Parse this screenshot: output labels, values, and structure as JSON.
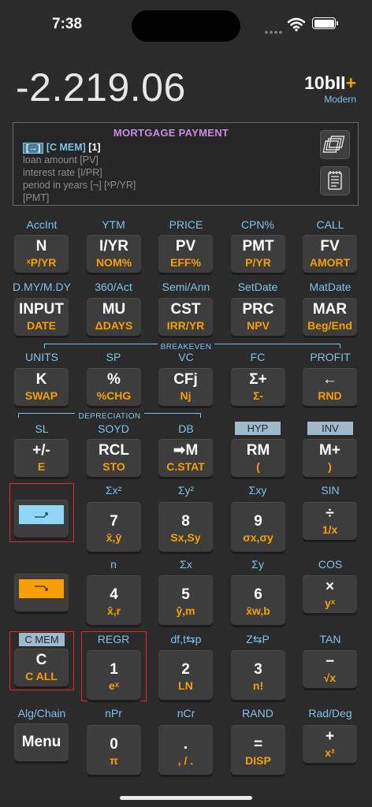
{
  "status": {
    "time": "7:38"
  },
  "display": {
    "value": "-2.219.06"
  },
  "brand": {
    "name": "10bII",
    "plus": "+",
    "subtitle": "Modern"
  },
  "panel": {
    "title": "MORTGAGE PAYMENT",
    "line1_box": "[→]",
    "line1_mem": "[C MEM]",
    "line1_num": "[1]",
    "line2": "loan amount   [PV]",
    "line3": "interest rate   [I/PR]",
    "line4": "period in years   [¬]  [ˣP/YR]",
    "line5": "[PMT]"
  },
  "labels": {
    "r1": [
      "AccInt",
      "YTM",
      "PRICE",
      "CPN%",
      "CALL"
    ],
    "r2": [
      "D.MY/M.DY",
      "360/Act",
      "Semi/Ann",
      "SetDate",
      "MatDate"
    ],
    "breakeven": "BREAKEVEN",
    "r3": [
      "UNITS",
      "SP",
      "VC",
      "FC",
      "PROFIT"
    ],
    "depreciation": "DEPRECIATION",
    "r4": [
      "SL",
      "SOYD",
      "DB",
      "HYP",
      "INV"
    ],
    "r5": [
      "Σx²",
      "Σy²",
      "Σxy",
      "SIN"
    ],
    "r6": [
      "n",
      "Σx",
      "Σy",
      "COS"
    ],
    "r7": [
      "C MEM",
      "REGR",
      "df,t⇆p",
      "Z⇆P",
      "TAN"
    ],
    "r8": [
      "Alg/Chain",
      "nPr",
      "nCr",
      "RAND",
      "Rad/Deg"
    ]
  },
  "keys": {
    "row1": [
      {
        "main": "N",
        "sub": "ˣP/YR"
      },
      {
        "main": "I/YR",
        "sub": "NOM%"
      },
      {
        "main": "PV",
        "sub": "EFF%"
      },
      {
        "main": "PMT",
        "sub": "P/YR"
      },
      {
        "main": "FV",
        "sub": "AMORT"
      }
    ],
    "row2": [
      {
        "main": "INPUT",
        "sub": "DATE"
      },
      {
        "main": "MU",
        "sub": "ΔDAYS"
      },
      {
        "main": "CST",
        "sub": "IRR/YR"
      },
      {
        "main": "PRC",
        "sub": "NPV"
      },
      {
        "main": "MAR",
        "sub": "Beg/End"
      }
    ],
    "row3": [
      {
        "main": "K",
        "sub": "SWAP"
      },
      {
        "main": "%",
        "sub": "%CHG"
      },
      {
        "main": "CFj",
        "sub": "Nj"
      },
      {
        "main": "Σ+",
        "sub": "Σ-"
      },
      {
        "main": "←",
        "sub": "RND"
      }
    ],
    "row4": [
      {
        "main": "+/-",
        "sub": "E"
      },
      {
        "main": "RCL",
        "sub": "STO"
      },
      {
        "main": "➡M",
        "sub": "C.STAT"
      },
      {
        "main": "RM",
        "sub": "("
      },
      {
        "main": "M+",
        "sub": ")"
      }
    ],
    "row5": [
      {
        "main": "7",
        "sub": "x̄,ȳ"
      },
      {
        "main": "8",
        "sub": "Sx,Sy"
      },
      {
        "main": "9",
        "sub": "σx,σy"
      },
      {
        "main": "÷",
        "sub": "1/x"
      }
    ],
    "row6": [
      {
        "main": "4",
        "sub": "x̂,r"
      },
      {
        "main": "5",
        "sub": "ŷ,m"
      },
      {
        "main": "6",
        "sub": "x̄w,b"
      },
      {
        "main": "×",
        "sub": "yˣ"
      }
    ],
    "row7": [
      {
        "main": "C",
        "sub": "C ALL"
      },
      {
        "main": "1",
        "sub": "eˣ"
      },
      {
        "main": "2",
        "sub": "LN"
      },
      {
        "main": "3",
        "sub": "n!"
      },
      {
        "main": "−",
        "sub": "√x"
      }
    ],
    "row8": [
      {
        "main": "Menu",
        "sub": ""
      },
      {
        "main": "0",
        "sub": "π"
      },
      {
        "main": ".",
        "sub": ", / ."
      },
      {
        "main": "=",
        "sub": "DISP"
      },
      {
        "main": "+",
        "sub": "x²"
      }
    ]
  },
  "colors": {
    "blue_shift": "#8fd6f8",
    "orange_shift": "#f5a000",
    "accent_label": "#7fc2e8",
    "red_outline": "#e0262b"
  }
}
